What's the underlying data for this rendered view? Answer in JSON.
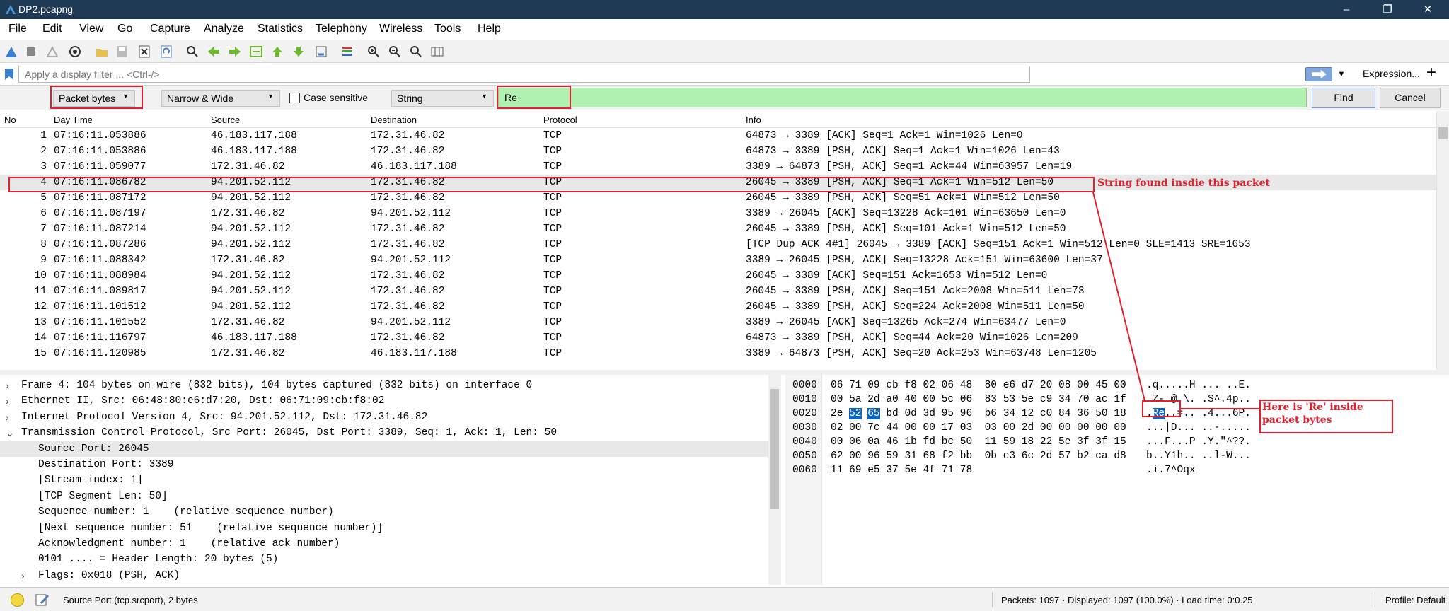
{
  "window": {
    "title": "DP2.pcapng",
    "minimize": "–",
    "maximize": "❐",
    "close": "✕"
  },
  "menu": [
    "File",
    "Edit",
    "View",
    "Go",
    "Capture",
    "Analyze",
    "Statistics",
    "Telephony",
    "Wireless",
    "Tools",
    "Help"
  ],
  "filter": {
    "placeholder": "Apply a display filter ... <Ctrl-/>",
    "expression_label": "Expression...",
    "add_label": "+"
  },
  "find": {
    "search_in": "Packet bytes",
    "char_width": "Narrow & Wide",
    "case_sensitive_label": "Case sensitive",
    "case_sensitive": false,
    "search_type": "String",
    "query": "Re",
    "find_label": "Find",
    "cancel_label": "Cancel"
  },
  "packet_list": {
    "columns": [
      "No",
      "Day Time",
      "Source",
      "Destination",
      "Protocol",
      "Info"
    ],
    "selected_no": "4",
    "rows": [
      {
        "no": "1",
        "time": "07:16:11.053886",
        "src": "46.183.117.188",
        "dst": "172.31.46.82",
        "proto": "TCP",
        "info": "64873 → 3389 [ACK] Seq=1 Ack=1 Win=1026 Len=0"
      },
      {
        "no": "2",
        "time": "07:16:11.053886",
        "src": "46.183.117.188",
        "dst": "172.31.46.82",
        "proto": "TCP",
        "info": "64873 → 3389 [PSH, ACK] Seq=1 Ack=1 Win=1026 Len=43"
      },
      {
        "no": "3",
        "time": "07:16:11.059077",
        "src": "172.31.46.82",
        "dst": "46.183.117.188",
        "proto": "TCP",
        "info": "3389 → 64873 [PSH, ACK] Seq=1 Ack=44 Win=63957 Len=19"
      },
      {
        "no": "4",
        "time": "07:16:11.086782",
        "src": "94.201.52.112",
        "dst": "172.31.46.82",
        "proto": "TCP",
        "info": "26045 → 3389 [PSH, ACK] Seq=1 Ack=1 Win=512 Len=50"
      },
      {
        "no": "5",
        "time": "07:16:11.087172",
        "src": "94.201.52.112",
        "dst": "172.31.46.82",
        "proto": "TCP",
        "info": "26045 → 3389 [PSH, ACK] Seq=51 Ack=1 Win=512 Len=50"
      },
      {
        "no": "6",
        "time": "07:16:11.087197",
        "src": "172.31.46.82",
        "dst": "94.201.52.112",
        "proto": "TCP",
        "info": "3389 → 26045 [ACK] Seq=13228 Ack=101 Win=63650 Len=0"
      },
      {
        "no": "7",
        "time": "07:16:11.087214",
        "src": "94.201.52.112",
        "dst": "172.31.46.82",
        "proto": "TCP",
        "info": "26045 → 3389 [PSH, ACK] Seq=101 Ack=1 Win=512 Len=50"
      },
      {
        "no": "8",
        "time": "07:16:11.087286",
        "src": "94.201.52.112",
        "dst": "172.31.46.82",
        "proto": "TCP",
        "info": "[TCP Dup ACK 4#1] 26045 → 3389 [ACK] Seq=151 Ack=1 Win=512 Len=0 SLE=1413 SRE=1653"
      },
      {
        "no": "9",
        "time": "07:16:11.088342",
        "src": "172.31.46.82",
        "dst": "94.201.52.112",
        "proto": "TCP",
        "info": "3389 → 26045 [PSH, ACK] Seq=13228 Ack=151 Win=63600 Len=37"
      },
      {
        "no": "10",
        "time": "07:16:11.088984",
        "src": "94.201.52.112",
        "dst": "172.31.46.82",
        "proto": "TCP",
        "info": "26045 → 3389 [ACK] Seq=151 Ack=1653 Win=512 Len=0"
      },
      {
        "no": "11",
        "time": "07:16:11.089817",
        "src": "94.201.52.112",
        "dst": "172.31.46.82",
        "proto": "TCP",
        "info": "26045 → 3389 [PSH, ACK] Seq=151 Ack=2008 Win=511 Len=73"
      },
      {
        "no": "12",
        "time": "07:16:11.101512",
        "src": "94.201.52.112",
        "dst": "172.31.46.82",
        "proto": "TCP",
        "info": "26045 → 3389 [PSH, ACK] Seq=224 Ack=2008 Win=511 Len=50"
      },
      {
        "no": "13",
        "time": "07:16:11.101552",
        "src": "172.31.46.82",
        "dst": "94.201.52.112",
        "proto": "TCP",
        "info": "3389 → 26045 [ACK] Seq=13265 Ack=274 Win=63477 Len=0"
      },
      {
        "no": "14",
        "time": "07:16:11.116797",
        "src": "46.183.117.188",
        "dst": "172.31.46.82",
        "proto": "TCP",
        "info": "64873 → 3389 [PSH, ACK] Seq=44 Ack=20 Win=1026 Len=209"
      },
      {
        "no": "15",
        "time": "07:16:11.120985",
        "src": "172.31.46.82",
        "dst": "46.183.117.188",
        "proto": "TCP",
        "info": "3389 → 64873 [PSH, ACK] Seq=20 Ack=253 Win=63748 Len=1205"
      }
    ]
  },
  "details": [
    {
      "text": "Frame 4: 104 bytes on wire (832 bits), 104 bytes captured (832 bits) on interface 0",
      "expander": "›",
      "indent": 0
    },
    {
      "text": "Ethernet II, Src: 06:48:80:e6:d7:20, Dst: 06:71:09:cb:f8:02",
      "expander": "›",
      "indent": 0
    },
    {
      "text": "Internet Protocol Version 4, Src: 94.201.52.112, Dst: 172.31.46.82",
      "expander": "›",
      "indent": 0
    },
    {
      "text": "Transmission Control Protocol, Src Port: 26045, Dst Port: 3389, Seq: 1, Ack: 1, Len: 50",
      "expander": "⌄",
      "indent": 0
    },
    {
      "text": "Source Port: 26045",
      "expander": "",
      "indent": 1
    },
    {
      "text": "Destination Port: 3389",
      "expander": "",
      "indent": 1
    },
    {
      "text": "[Stream index: 1]",
      "expander": "",
      "indent": 1
    },
    {
      "text": "[TCP Segment Len: 50]",
      "expander": "",
      "indent": 1
    },
    {
      "text": "Sequence number: 1    (relative sequence number)",
      "expander": "",
      "indent": 1
    },
    {
      "text": "[Next sequence number: 51    (relative sequence number)]",
      "expander": "",
      "indent": 1
    },
    {
      "text": "Acknowledgment number: 1    (relative ack number)",
      "expander": "",
      "indent": 1
    },
    {
      "text": "0101 .... = Header Length: 20 bytes (5)",
      "expander": "",
      "indent": 1
    },
    {
      "text": "Flags: 0x018 (PSH, ACK)",
      "expander": "›",
      "indent": 1
    }
  ],
  "bytes": [
    {
      "offset": "0000",
      "hex": [
        "06",
        "71",
        "09",
        "cb",
        "f8",
        "02",
        "06",
        "48",
        "80",
        "e6",
        "d7",
        "20",
        "08",
        "00",
        "45",
        "00"
      ],
      "ascii": ".q.....H ... ..E."
    },
    {
      "offset": "0010",
      "hex": [
        "00",
        "5a",
        "2d",
        "a0",
        "40",
        "00",
        "5c",
        "06",
        "83",
        "53",
        "5e",
        "c9",
        "34",
        "70",
        "ac",
        "1f"
      ],
      "ascii": ".Z-.@.\\. .S^.4p.."
    },
    {
      "offset": "0020",
      "hex": [
        "2e",
        "52",
        "65",
        "bd",
        "0d",
        "3d",
        "95",
        "96",
        "b6",
        "34",
        "12",
        "c0",
        "84",
        "36",
        "50",
        "18"
      ],
      "ascii": ".Re..=.. .4...6P."
    },
    {
      "offset": "0030",
      "hex": [
        "02",
        "00",
        "7c",
        "44",
        "00",
        "00",
        "17",
        "03",
        "03",
        "00",
        "2d",
        "00",
        "00",
        "00",
        "00",
        "00"
      ],
      "ascii": "...|D... ..-....."
    },
    {
      "offset": "0040",
      "hex": [
        "00",
        "06",
        "0a",
        "46",
        "1b",
        "fd",
        "bc",
        "50",
        "11",
        "59",
        "18",
        "22",
        "5e",
        "3f",
        "3f",
        "15"
      ],
      "ascii": "...F...P .Y.\"^??."
    },
    {
      "offset": "0050",
      "hex": [
        "62",
        "00",
        "96",
        "59",
        "31",
        "68",
        "f2",
        "bb",
        "0b",
        "e3",
        "6c",
        "2d",
        "57",
        "b2",
        "ca",
        "d8"
      ],
      "ascii": "b..Y1h.. ..l-W..."
    },
    {
      "offset": "0060",
      "hex": [
        "11",
        "69",
        "e5",
        "37",
        "5e",
        "4f",
        "71",
        "78"
      ],
      "ascii": ".i.7^Oqx"
    }
  ],
  "highlight": {
    "row": 2,
    "hex_start": 1,
    "hex_end": 2
  },
  "status": {
    "field": "Source Port (tcp.srcport), 2 bytes",
    "packets": "Packets: 1097 · Displayed: 1097 (100.0%) · Load time: 0:0.25",
    "profile": "Profile: Default"
  },
  "annotations": {
    "packet": "String found insdie this packet",
    "bytes": "Here is 'Re' inside packet bytes"
  },
  "colors": {
    "titlebar": "#1e3a54",
    "find_field": "#b0f0b0",
    "annotation": "#e0202c",
    "highlight": "#0a64c8"
  }
}
